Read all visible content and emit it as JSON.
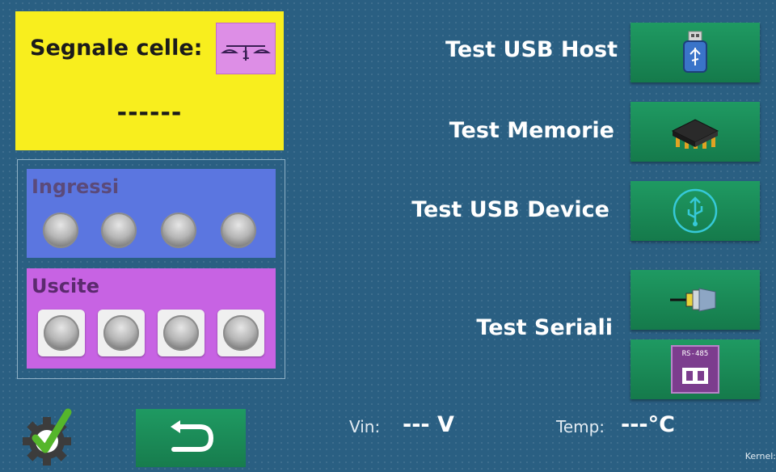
{
  "weighing": {
    "label": "Segnale celle:",
    "scale_icon_label": "1",
    "value": "------",
    "panel_color": "#f8ee1e"
  },
  "io": {
    "inputs_title": "Ingressi",
    "outputs_title": "Uscite",
    "inputs_color": "#5b76e0",
    "outputs_color": "#c763e3",
    "led_count": 4
  },
  "tests": {
    "usb_host": {
      "label": "Test USB Host",
      "icon": "usb-stick-icon"
    },
    "memorie": {
      "label": "Test Memorie",
      "icon": "memory-chip-icon"
    },
    "usb_device": {
      "label": "Test USB Device",
      "icon": "usb-symbol-icon"
    },
    "seriali": {
      "label": "Test Seriali",
      "icons": [
        "serial-connector-icon",
        "rs485-icon"
      ],
      "rs485_text": "RS-485"
    }
  },
  "footer": {
    "vin_label": "Vin:",
    "vin_value": "--- V",
    "temp_label": "Temp:",
    "temp_value": "---°C",
    "kernel_label": "Kernel:"
  },
  "colors": {
    "background": "#2a5f82",
    "button_green": "#1b8d58"
  }
}
